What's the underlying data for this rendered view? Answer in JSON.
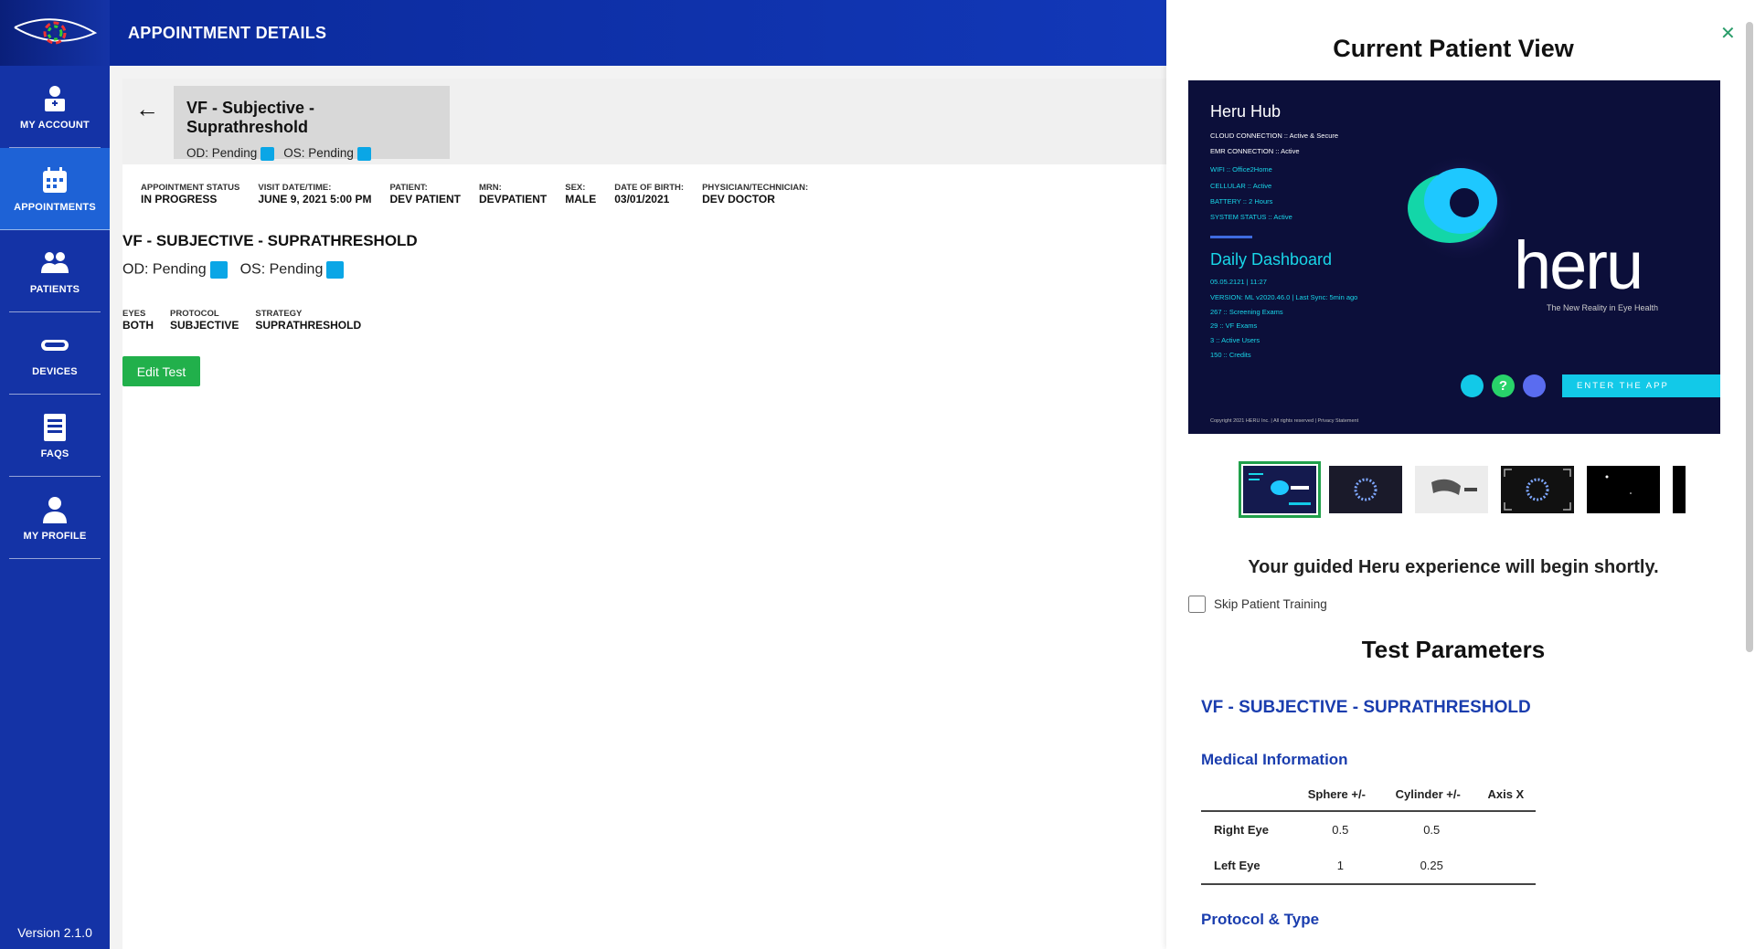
{
  "header": {
    "title": "APPOINTMENT DETAILS"
  },
  "sidebar": {
    "items": [
      {
        "label": "MY ACCOUNT",
        "icon": "account-icon"
      },
      {
        "label": "APPOINTMENTS",
        "icon": "calendar-icon",
        "active": true
      },
      {
        "label": "PATIENTS",
        "icon": "patients-icon"
      },
      {
        "label": "DEVICES",
        "icon": "headset-icon"
      },
      {
        "label": "FAQS",
        "icon": "faq-icon"
      },
      {
        "label": "MY PROFILE",
        "icon": "profile-icon"
      }
    ],
    "version": "Version 2.1.0"
  },
  "test_card": {
    "title": "VF - Subjective - Suprathreshold",
    "od": "OD: Pending",
    "os": "OS: Pending"
  },
  "meta": [
    {
      "label": "APPOINTMENT STATUS",
      "value": "IN PROGRESS"
    },
    {
      "label": "VISIT DATE/TIME:",
      "value": "JUNE 9, 2021 5:00 PM"
    },
    {
      "label": "PATIENT:",
      "value": "DEV PATIENT"
    },
    {
      "label": "MRN:",
      "value": "DEVPATIENT"
    },
    {
      "label": "SEX:",
      "value": "MALE"
    },
    {
      "label": "DATE OF BIRTH:",
      "value": "03/01/2021"
    },
    {
      "label": "PHYSICIAN/TECHNICIAN:",
      "value": "DEV DOCTOR"
    }
  ],
  "section": {
    "title": "VF - SUBJECTIVE - SUPRATHRESHOLD",
    "od": "OD: Pending",
    "os": "OS: Pending",
    "params": [
      {
        "label": "EYES",
        "value": "BOTH"
      },
      {
        "label": "PROTOCOL",
        "value": "SUBJECTIVE"
      },
      {
        "label": "STRATEGY",
        "value": "SUPRATHRESHOLD"
      }
    ],
    "edit_label": "Edit Test"
  },
  "panel": {
    "title": "Current Patient View",
    "preview": {
      "hub_title": "Heru Hub",
      "lines": [
        "CLOUD CONNECTION :: Active & Secure",
        "EMR CONNECTION :: Active",
        "WIFI :: Office2Home",
        "CELLULAR :: Active",
        "BATTERY :: 2 Hours",
        "SYSTEM STATUS :: Active"
      ],
      "dashboard_title": "Daily Dashboard",
      "dash_lines": [
        "05.05.2121 | 11:27",
        "VERSION: ML v2020.46.0 | Last Sync: 5min ago",
        "267 :: Screening Exams",
        "29 :: VF Exams",
        "3 :: Active Users",
        "150 :: Credits"
      ],
      "logo_text": "heru",
      "tagline": "The New Reality in Eye Health",
      "enter_label": "ENTER THE APP",
      "copyright": "Copyright 2021 HERU Inc. | All rights reserved | Privacy Statement"
    },
    "guided_text": "Your guided Heru experience will begin shortly.",
    "skip_label": "Skip Patient Training",
    "test_params_title": "Test Parameters",
    "vf_title": "VF - SUBJECTIVE - SUPRATHRESHOLD",
    "medical_title": "Medical Information",
    "table": {
      "headers": [
        "",
        "Sphere +/-",
        "Cylinder +/-",
        "Axis X"
      ],
      "rows": [
        {
          "label": "Right Eye",
          "sphere": "0.5",
          "cylinder": "0.5",
          "axis": ""
        },
        {
          "label": "Left Eye",
          "sphere": "1",
          "cylinder": "0.25",
          "axis": ""
        }
      ]
    },
    "protocol_title": "Protocol & Type"
  },
  "colors": {
    "sidebar": "#1433a6",
    "accent": "#1a3dae",
    "pending": "#0aa6e6",
    "edit": "#21b04b"
  }
}
